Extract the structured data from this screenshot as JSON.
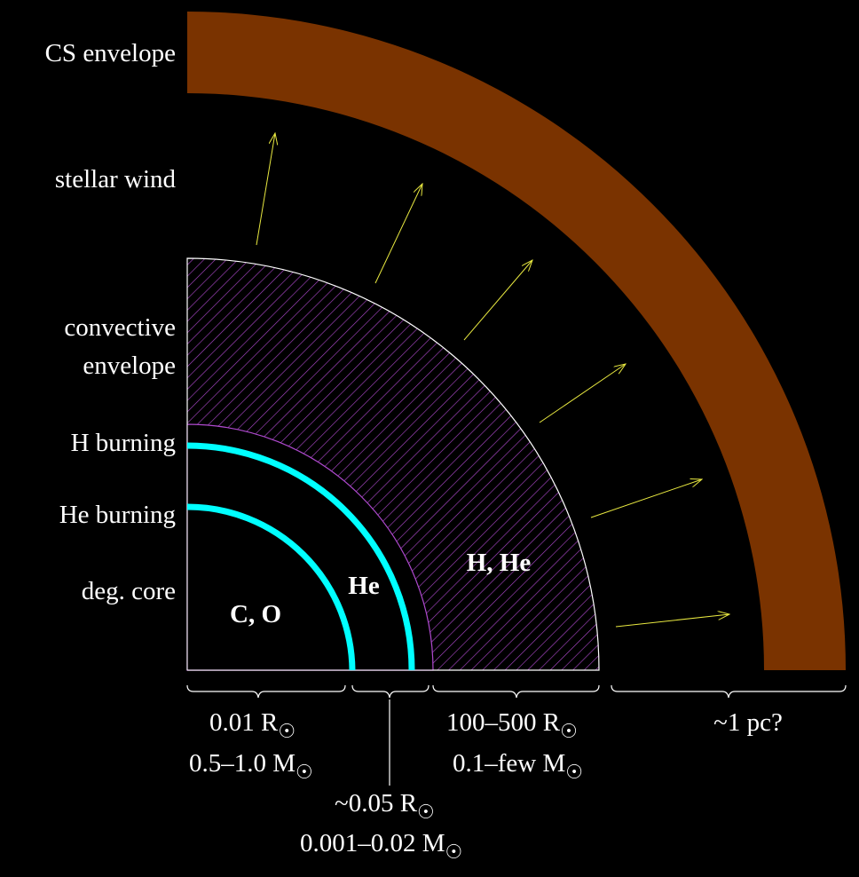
{
  "layers": {
    "cs_envelope": "CS envelope",
    "stellar_wind": "stellar wind",
    "convective_envelope_1": "convective",
    "convective_envelope_2": "envelope",
    "h_burning": "H burning",
    "he_burning": "He burning",
    "deg_core": "deg. core"
  },
  "regions": {
    "core": "C, O",
    "he": "He",
    "h_he": "H, He"
  },
  "scales": {
    "core_radius": "0.01 R",
    "core_mass": "0.5–1.0 M",
    "he_radius": "~0.05 R",
    "he_mass": "0.001–0.02 M",
    "env_radius": "100–500 R",
    "env_mass": "0.1–few M",
    "cs_distance": "~1 pc?"
  },
  "colors": {
    "cs_envelope": "#7a3300",
    "burning_shell": "#00ffff",
    "hatch": "#b04ad0",
    "wind_arrow": "#e8e840",
    "background": "#000000"
  }
}
